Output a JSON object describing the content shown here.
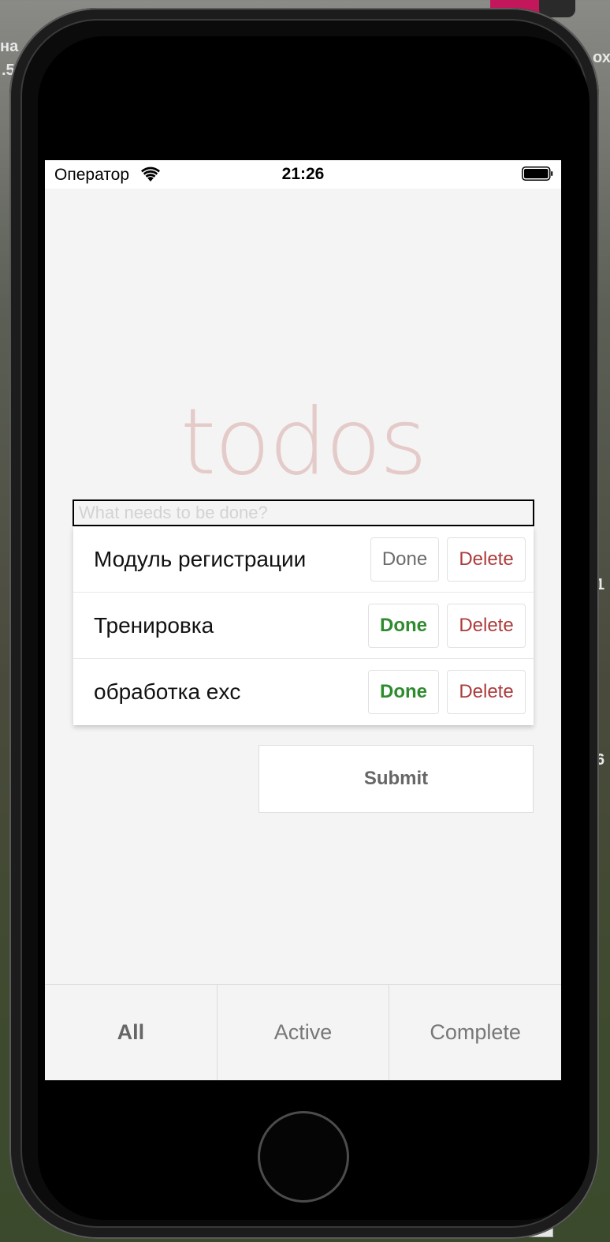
{
  "status_bar": {
    "carrier": "Оператор",
    "time": "21:26"
  },
  "app": {
    "title": "todos",
    "new_todo_placeholder": "What needs to be done?",
    "todos": [
      {
        "text": "Модуль регистрации",
        "done_label": "Done",
        "delete_label": "Delete",
        "complete": false
      },
      {
        "text": "Тренировка",
        "done_label": "Done",
        "delete_label": "Delete",
        "complete": true
      },
      {
        "text": "обработка exc",
        "done_label": "Done",
        "delete_label": "Delete",
        "complete": true
      }
    ],
    "submit_label": "Submit",
    "tabs": [
      {
        "label": "All",
        "selected": true
      },
      {
        "label": "Active",
        "selected": false
      },
      {
        "label": "Complete",
        "selected": false
      }
    ]
  },
  "background": {
    "left_text_1": "на",
    "left_text_2": ".5",
    "right_text_1": "ох",
    "right_text_2": "1",
    "right_text_3": "6"
  },
  "colors": {
    "title": "#e4cbc9",
    "done_complete": "#2e8b2e",
    "delete": "#ad3b3b",
    "screen_bg": "#f4f4f4"
  }
}
